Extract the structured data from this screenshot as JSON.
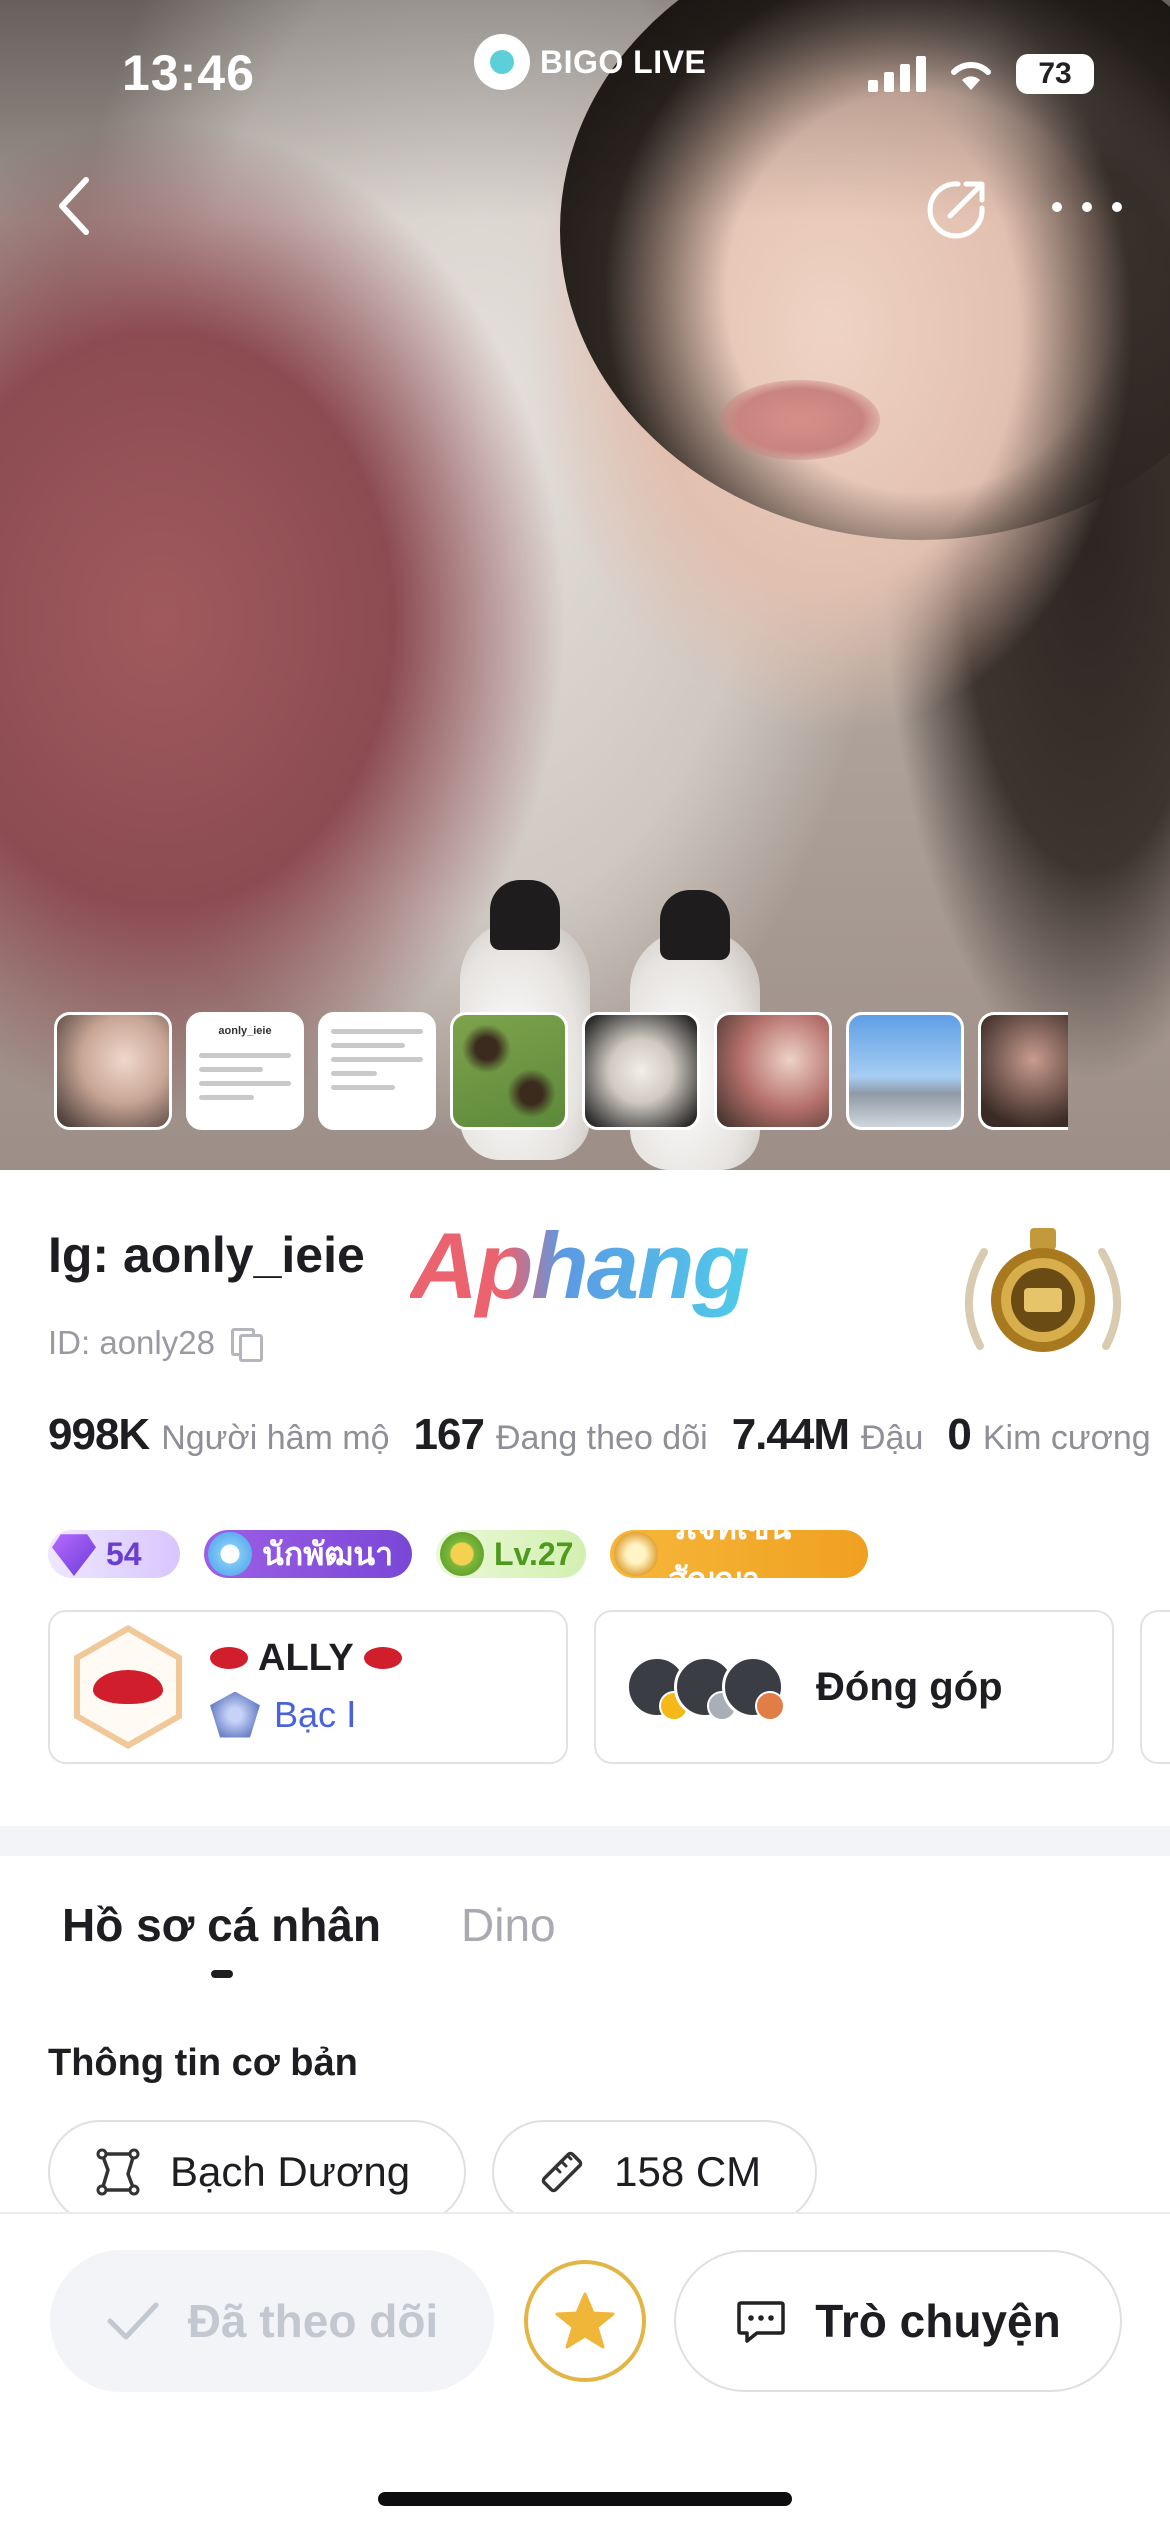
{
  "status_bar": {
    "time": "13:46",
    "battery": "73"
  },
  "app_brand": "BIGO LIVE",
  "thumbnails": {
    "note_title": "aonly_ieie",
    "items": [
      "photo-1",
      "profile-screenshot",
      "note-screenshot",
      "cats",
      "white-cat",
      "photo-2",
      "riverside",
      "photo-3"
    ]
  },
  "profile": {
    "name": "Ig: aonly_ieie",
    "watermark": "Aphang",
    "id_label": "ID: aonly28"
  },
  "stats": [
    {
      "value": "998K",
      "label": "Người hâm mộ"
    },
    {
      "value": "167",
      "label": "Đang theo dõi"
    },
    {
      "value": "7.44M",
      "label": "Đậu"
    },
    {
      "value": "0",
      "label": "Kim cương"
    }
  ],
  "badges": {
    "level_number": "54",
    "developer": "นักพัฒนา",
    "lv": "Lv.27",
    "contract": "วีเจที่เซ็นสัญญา"
  },
  "cards": {
    "ally_name": "ALLY",
    "ally_rank": "Bạc Ⅰ",
    "contribution": "Đóng góp"
  },
  "tabs": [
    "Hồ sơ cá nhân",
    "Dino"
  ],
  "section_title": "Thông tin cơ bản",
  "info_chips": [
    "Bạch Dương",
    "158 CM"
  ],
  "bottom_bar": {
    "follow_label": "Đã theo dõi",
    "chat_label": "Trò chuyện"
  },
  "colors": {
    "accent_star": "#e3b544",
    "rank_text": "#4a63d8",
    "muted_text": "#8f8f98"
  }
}
